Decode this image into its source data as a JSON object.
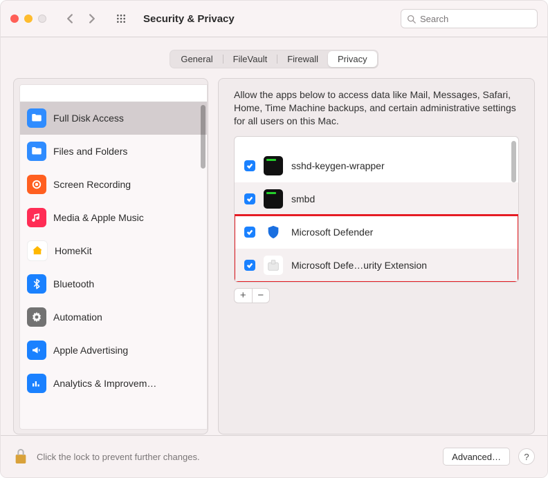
{
  "window": {
    "title": "Security & Privacy"
  },
  "search": {
    "placeholder": "Search"
  },
  "tabs": [
    {
      "label": "General",
      "active": false
    },
    {
      "label": "FileVault",
      "active": false
    },
    {
      "label": "Firewall",
      "active": false
    },
    {
      "label": "Privacy",
      "active": true
    }
  ],
  "sidebar": {
    "items": [
      {
        "label": "Full Disk Access",
        "icon": "folder",
        "color": "#2f8cff",
        "selected": true
      },
      {
        "label": "Files and Folders",
        "icon": "folder",
        "color": "#2f8cff",
        "selected": false
      },
      {
        "label": "Screen Recording",
        "icon": "record",
        "color": "#ff5f20",
        "selected": false
      },
      {
        "label": "Media & Apple Music",
        "icon": "music",
        "color": "#ff2d55",
        "selected": false
      },
      {
        "label": "HomeKit",
        "icon": "home",
        "color": "#ffb800",
        "selected": false
      },
      {
        "label": "Bluetooth",
        "icon": "bluetooth",
        "color": "#1a81ff",
        "selected": false
      },
      {
        "label": "Automation",
        "icon": "gear",
        "color": "#727272",
        "selected": false
      },
      {
        "label": "Apple Advertising",
        "icon": "megaphone",
        "color": "#1a81ff",
        "selected": false
      },
      {
        "label": "Analytics & Improvem…",
        "icon": "chart",
        "color": "#1a81ff",
        "selected": false
      }
    ]
  },
  "detail": {
    "description": "Allow the apps below to access data like Mail, Messages, Safari, Home, Time Machine backups, and certain administrative settings for all users on this Mac.",
    "apps": [
      {
        "checked": true,
        "name": "sshd-keygen-wrapper",
        "icon": "terminal",
        "highlighted": false
      },
      {
        "checked": true,
        "name": "smbd",
        "icon": "terminal",
        "highlighted": false
      },
      {
        "checked": true,
        "name": "Microsoft Defender",
        "icon": "shield",
        "highlighted": true
      },
      {
        "checked": true,
        "name": "Microsoft Defe…urity Extension",
        "icon": "extension",
        "highlighted": true
      }
    ]
  },
  "footer": {
    "lock_text": "Click the lock to prevent further changes.",
    "advanced_label": "Advanced…",
    "help_label": "?"
  }
}
